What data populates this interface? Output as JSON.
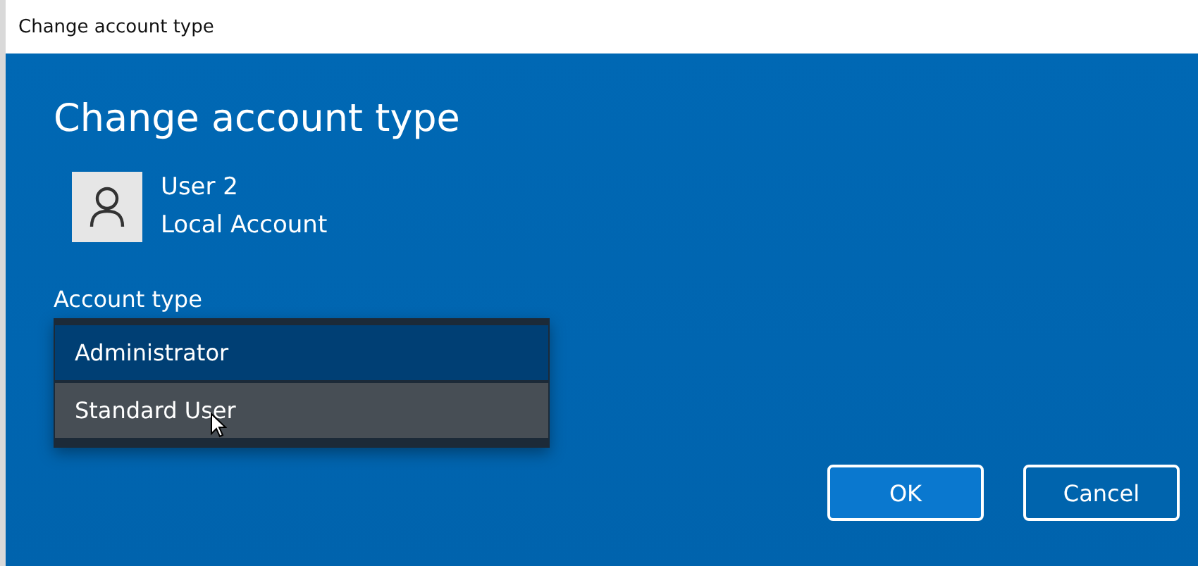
{
  "window": {
    "title": "Change account type"
  },
  "heading": "Change account type",
  "user": {
    "name": "User 2",
    "account": "Local Account"
  },
  "account_type": {
    "label": "Account type",
    "options": [
      {
        "label": "Administrator",
        "selected": true,
        "hovered": false
      },
      {
        "label": "Standard User",
        "selected": false,
        "hovered": true
      }
    ]
  },
  "buttons": [
    {
      "label": "OK",
      "default": true
    },
    {
      "label": "Cancel",
      "default": false
    }
  ]
}
